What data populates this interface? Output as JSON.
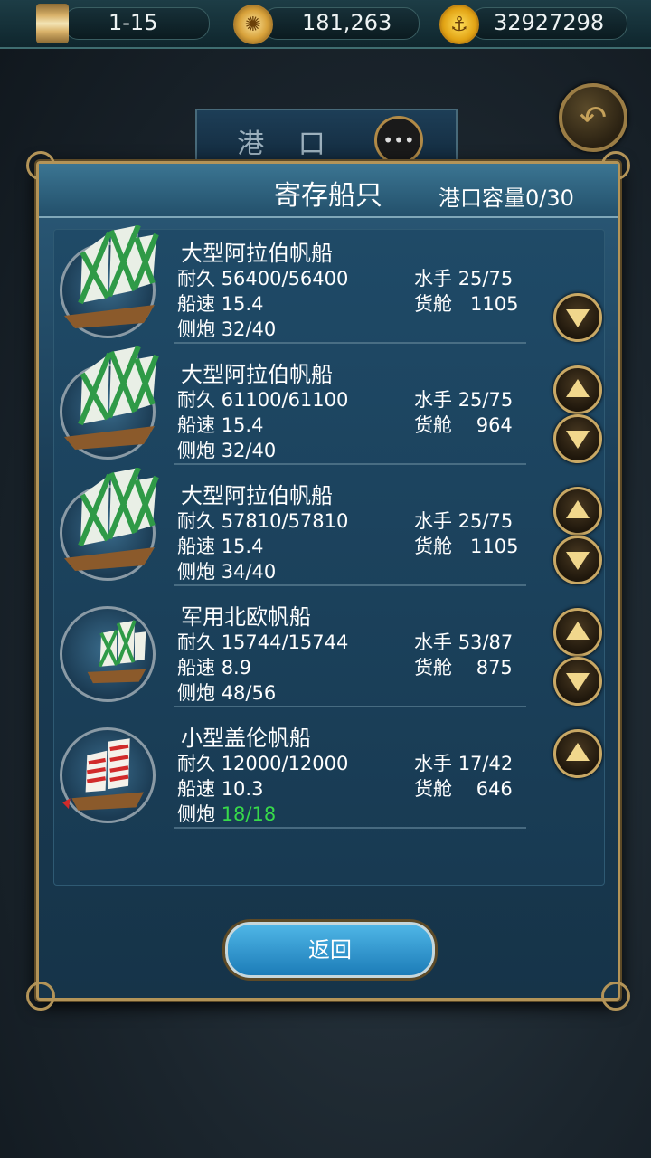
{
  "hud": {
    "level": "1-15",
    "coins": "181,263",
    "gold": "32927298",
    "icons": [
      "hourglass-icon",
      "compass-icon",
      "anchor-coin-icon"
    ]
  },
  "background": {
    "port_title": "港 口"
  },
  "dialog": {
    "title": "寄存船只",
    "capacity": "港口容量0/30",
    "return_label": "返回"
  },
  "labels": {
    "durability": "耐久",
    "speed": "船速",
    "cannons": "侧炮",
    "sailors": "水手",
    "cargo": "货舱"
  },
  "ships": [
    {
      "name": "大型阿拉伯帆船",
      "durability": "56400/56400",
      "speed": "15.4",
      "cannons": "32/40",
      "sailors": "25/75",
      "cargo": "1105",
      "sail_color": "#2f9a47",
      "has_up": false,
      "has_down": true
    },
    {
      "name": "大型阿拉伯帆船",
      "durability": "61100/61100",
      "speed": "15.4",
      "cannons": "32/40",
      "sailors": "25/75",
      "cargo": "964",
      "sail_color": "#2f9a47",
      "has_up": true,
      "has_down": true
    },
    {
      "name": "大型阿拉伯帆船",
      "durability": "57810/57810",
      "speed": "15.4",
      "cannons": "34/40",
      "sailors": "25/75",
      "cargo": "1105",
      "sail_color": "#2f9a47",
      "has_up": true,
      "has_down": true
    },
    {
      "name": "军用北欧帆船",
      "durability": "15744/15744",
      "speed": "8.9",
      "cannons": "48/56",
      "sailors": "53/87",
      "cargo": "875",
      "sail_color": "#2f9a47",
      "has_up": true,
      "has_down": true
    },
    {
      "name": "小型盖伦帆船",
      "durability": "12000/12000",
      "speed": "10.3",
      "cannons": "18/18",
      "sailors": "17/42",
      "cargo": "646",
      "sail_color": "#d12a2a",
      "has_up": true,
      "has_down": false
    }
  ]
}
